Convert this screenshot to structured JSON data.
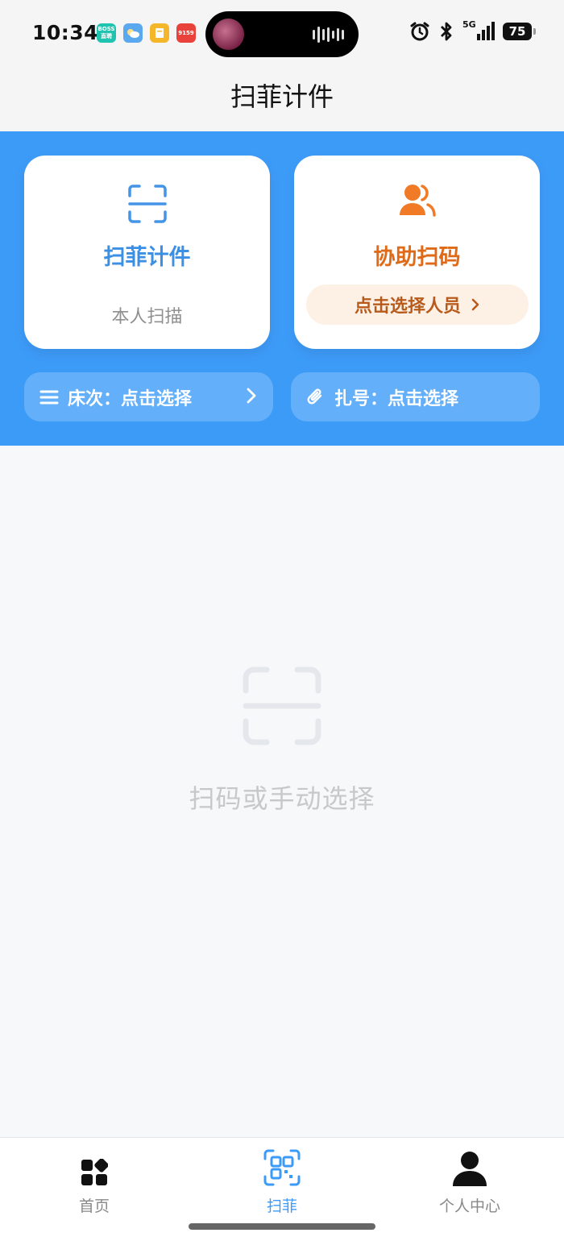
{
  "status_bar": {
    "time": "10:34",
    "app_badges": [
      "BOSS 直聘",
      "",
      "",
      "9159"
    ],
    "network": "5G",
    "battery": "75"
  },
  "nav": {
    "title": "扫菲计件"
  },
  "cards": {
    "self": {
      "title": "扫菲计件",
      "subtitle": "本人扫描",
      "accent": "#3b8fe4"
    },
    "assist": {
      "title": "协助扫码",
      "button_label": "点击选择人员",
      "accent": "#df6a17"
    }
  },
  "filters": {
    "bed_label": "床次：点击选择",
    "tie_label": "扎号：点击选择"
  },
  "empty_state": {
    "text": "扫码或手动选择"
  },
  "tab_bar": {
    "tabs": [
      {
        "label": "首页",
        "icon": "grid-icon"
      },
      {
        "label": "扫菲",
        "icon": "qr-scan-icon",
        "active": true
      },
      {
        "label": "个人中心",
        "icon": "user-icon"
      }
    ],
    "active_color": "#3d9bf8"
  },
  "colors": {
    "header_blue": "#3d9bf8",
    "orange": "#df6a17"
  }
}
